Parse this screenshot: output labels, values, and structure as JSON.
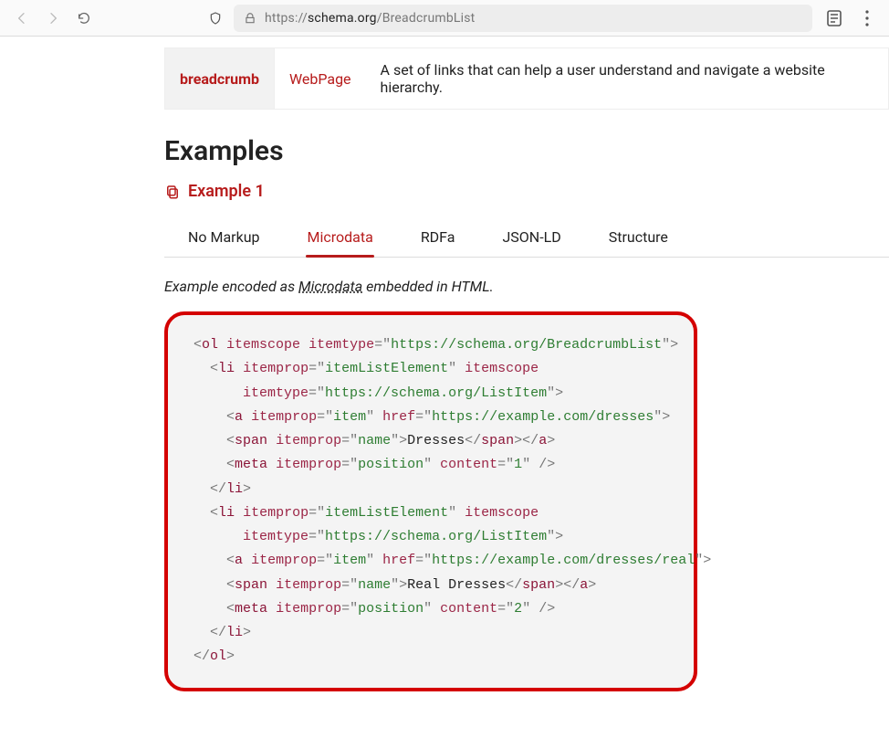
{
  "browser": {
    "url_prefix": "https://",
    "url_host": "schema.org",
    "url_path": "/BreadcrumbList"
  },
  "prop_row": {
    "name": "breadcrumb",
    "type": "WebPage",
    "desc": "A set of links that can help a user understand and navigate a website hierarchy."
  },
  "headings": {
    "examples": "Examples",
    "example1": "Example 1"
  },
  "tabs": {
    "no_markup": "No Markup",
    "microdata": "Microdata",
    "rdfa": "RDFa",
    "jsonld": "JSON-LD",
    "structure": "Structure"
  },
  "note": {
    "before": "Example encoded as ",
    "link": "Microdata",
    "after": " embedded in HTML."
  },
  "code": {
    "ol_tag": "ol",
    "li_tag": "li",
    "a_tag": "a",
    "span_tag": "span",
    "meta_tag": "meta",
    "itemscope": "itemscope",
    "itemtype": "itemtype",
    "itemprop": "itemprop",
    "href": "href",
    "content": "content",
    "ol_itemtype": "https://schema.org/BreadcrumbList",
    "li_itemprop": "itemListElement",
    "li_itemtype": "https://schema.org/ListItem",
    "a_itemprop": "item",
    "href1": "https://example.com/dresses",
    "span_itemprop": "name",
    "text1": "Dresses",
    "meta_itemprop": "position",
    "pos1": "1",
    "href2": "https://example.com/dresses/real",
    "text2": "Real Dresses",
    "pos2": "2"
  }
}
